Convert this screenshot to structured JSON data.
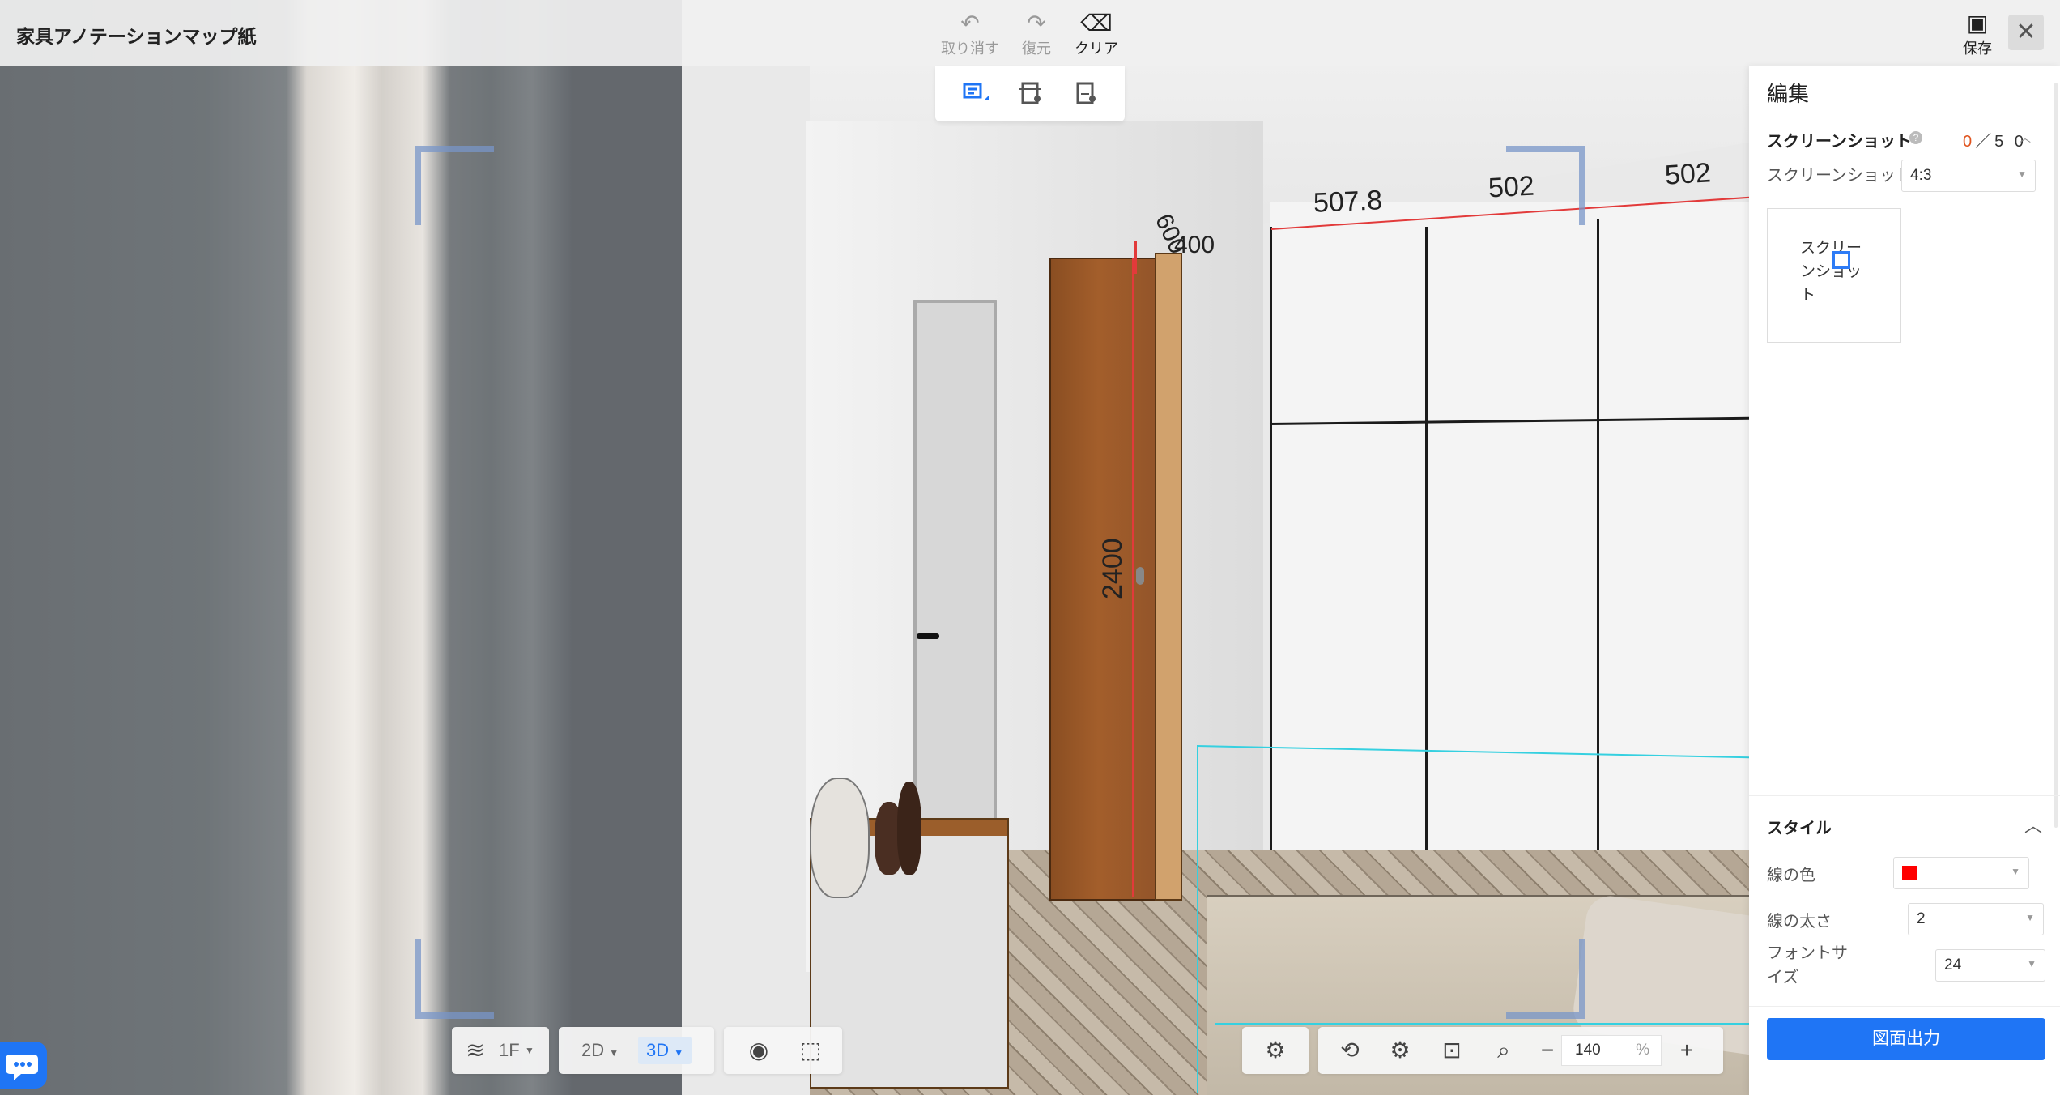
{
  "app": {
    "title": "家具アノテーションマップ紙"
  },
  "toolbar": {
    "undo_label": "取り消す",
    "redo_label": "復元",
    "clear_label": "クリア",
    "save_label": "保存"
  },
  "dimensions": {
    "top_1": "507.8",
    "top_2": "502",
    "top_3": "502",
    "depth": "600",
    "width": "400",
    "height": "2400"
  },
  "panel": {
    "title": "編集",
    "screenshot": {
      "section_title": "スクリーンショット",
      "count_current": "0",
      "count_sep": "／",
      "count_max": "5 0",
      "ratio_label": "スクリーンショット の比率",
      "ratio_value": "4:3",
      "card_label": "スクリーンショット"
    },
    "style": {
      "section_title": "スタイル",
      "line_color_label": "線の色",
      "line_color_value": "#ff0000",
      "line_width_label": "線の太さ",
      "line_width_value": "2",
      "font_size_label": "フォントサイズ",
      "font_size_value": "24"
    },
    "export_label": "図面出力"
  },
  "bottom": {
    "floor_label": "1F",
    "view_2d": "2D",
    "view_3d": "3D",
    "zoom_value": "140",
    "zoom_unit": "%"
  },
  "colors": {
    "accent": "#1f75f5",
    "count_highlight": "#e0541f",
    "dimension_line": "#e23a3a"
  }
}
